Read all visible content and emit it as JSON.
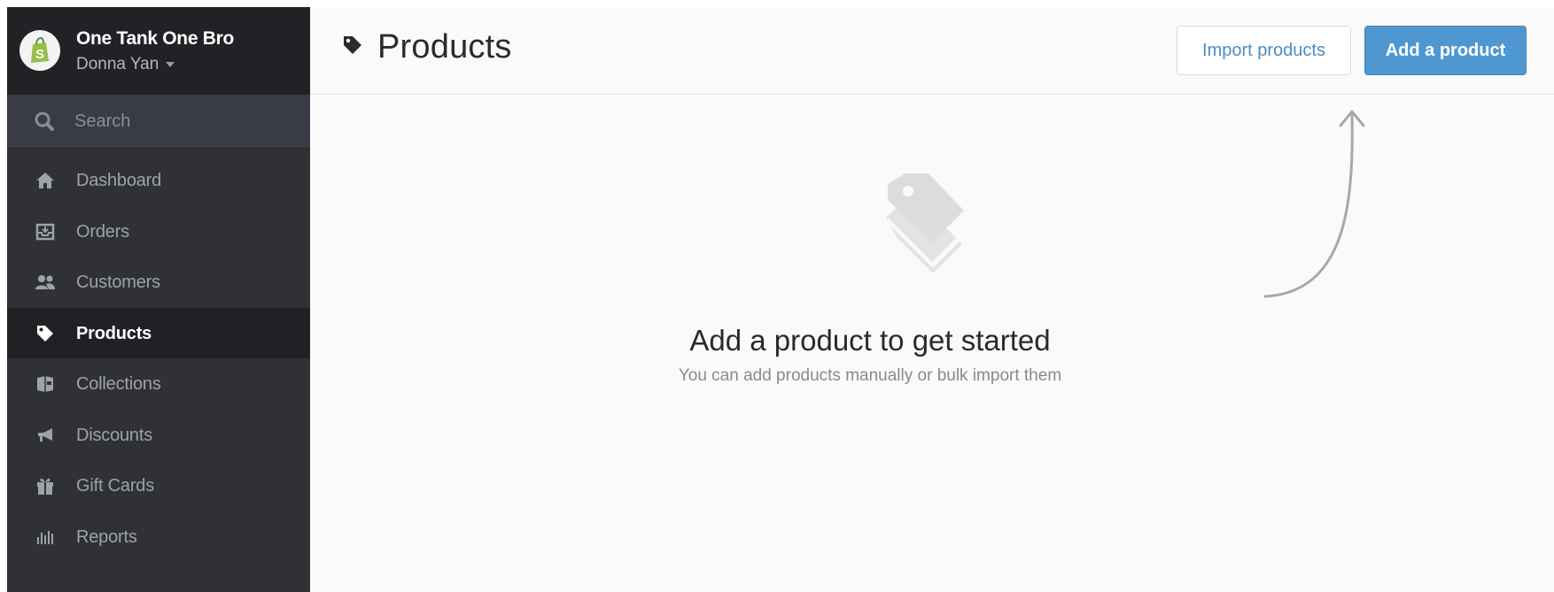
{
  "store": {
    "name": "One Tank One Bro",
    "user": "Donna Yan"
  },
  "search": {
    "label": "Search"
  },
  "nav": {
    "items": [
      {
        "label": "Dashboard",
        "icon": "home-icon"
      },
      {
        "label": "Orders",
        "icon": "inbox-icon"
      },
      {
        "label": "Customers",
        "icon": "users-icon"
      },
      {
        "label": "Products",
        "icon": "tag-icon",
        "active": true
      },
      {
        "label": "Collections",
        "icon": "box-icon"
      },
      {
        "label": "Discounts",
        "icon": "megaphone-icon"
      },
      {
        "label": "Gift Cards",
        "icon": "gift-icon"
      },
      {
        "label": "Reports",
        "icon": "bar-chart-icon"
      }
    ]
  },
  "header": {
    "title": "Products",
    "import_label": "Import products",
    "add_label": "Add a product"
  },
  "empty_state": {
    "heading": "Add a product to get started",
    "subtext": "You can add products manually or bulk import them"
  },
  "colors": {
    "sidebar_bg": "#2f3136",
    "sidebar_active_bg": "#202125",
    "accent_blue": "#4f97d1",
    "link_blue": "#4a8dc2"
  }
}
